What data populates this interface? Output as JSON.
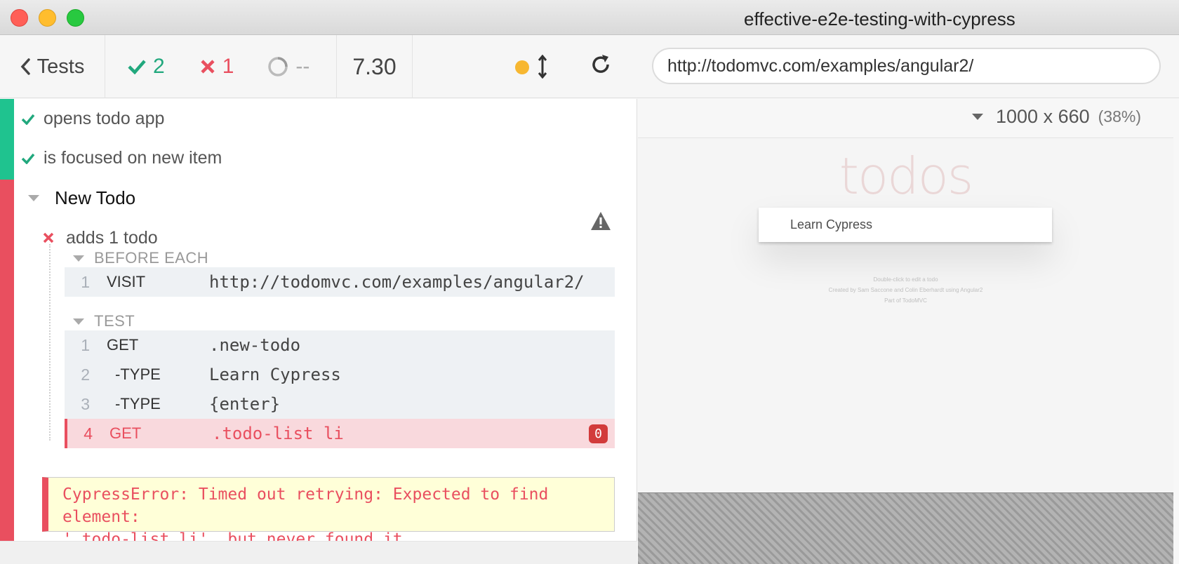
{
  "window": {
    "title": "effective-e2e-testing-with-cypress"
  },
  "header": {
    "tests_label": "Tests",
    "passed_count": "2",
    "failed_count": "1",
    "pending_count": "--",
    "duration": "7.30",
    "url": "http://todomvc.com/examples/angular2/",
    "viewport_size": "1000 x 660",
    "viewport_scale": "(38%)"
  },
  "colors": {
    "passed": "#21a87d",
    "failed": "#e94f5f",
    "running_dot": "#f7b731",
    "error_background": "#ffffd8"
  },
  "reporter": {
    "tests": [
      {
        "title": "opens todo app",
        "state": "passed"
      },
      {
        "title": "is focused on new item",
        "state": "passed"
      }
    ],
    "suite": {
      "title": "New Todo",
      "failed_test": "adds 1 todo",
      "before_each_label": "BEFORE EACH",
      "test_label": "TEST",
      "before_each_commands": [
        {
          "num": "1",
          "name": "VISIT",
          "message": "http://todomvc.com/examples/angular2/"
        }
      ],
      "test_commands": [
        {
          "num": "1",
          "name": "GET",
          "message": ".new-todo"
        },
        {
          "num": "2",
          "name": "-TYPE",
          "message": "Learn Cypress"
        },
        {
          "num": "3",
          "name": "-TYPE",
          "message": "{enter}"
        },
        {
          "num": "4",
          "name": "GET",
          "message": ".todo-list li",
          "badge": "0",
          "state": "failed"
        }
      ],
      "error_line1": "CypressError: Timed out retrying: Expected to find element:",
      "error_line2": "'.todo-list li', but never found it."
    }
  },
  "aut": {
    "heading": "todos",
    "input_value": "Learn Cypress",
    "footer1": "Double-click to edit a todo",
    "footer2": "Created by Sam Saccone and Colin Eberhardt using Angular2",
    "footer3": "Part of TodoMVC"
  },
  "icons": [
    "chevron-left-icon",
    "check-icon",
    "x-icon",
    "spinner-icon",
    "resize-icon",
    "reload-icon",
    "warning-icon",
    "caret-down-icon"
  ]
}
